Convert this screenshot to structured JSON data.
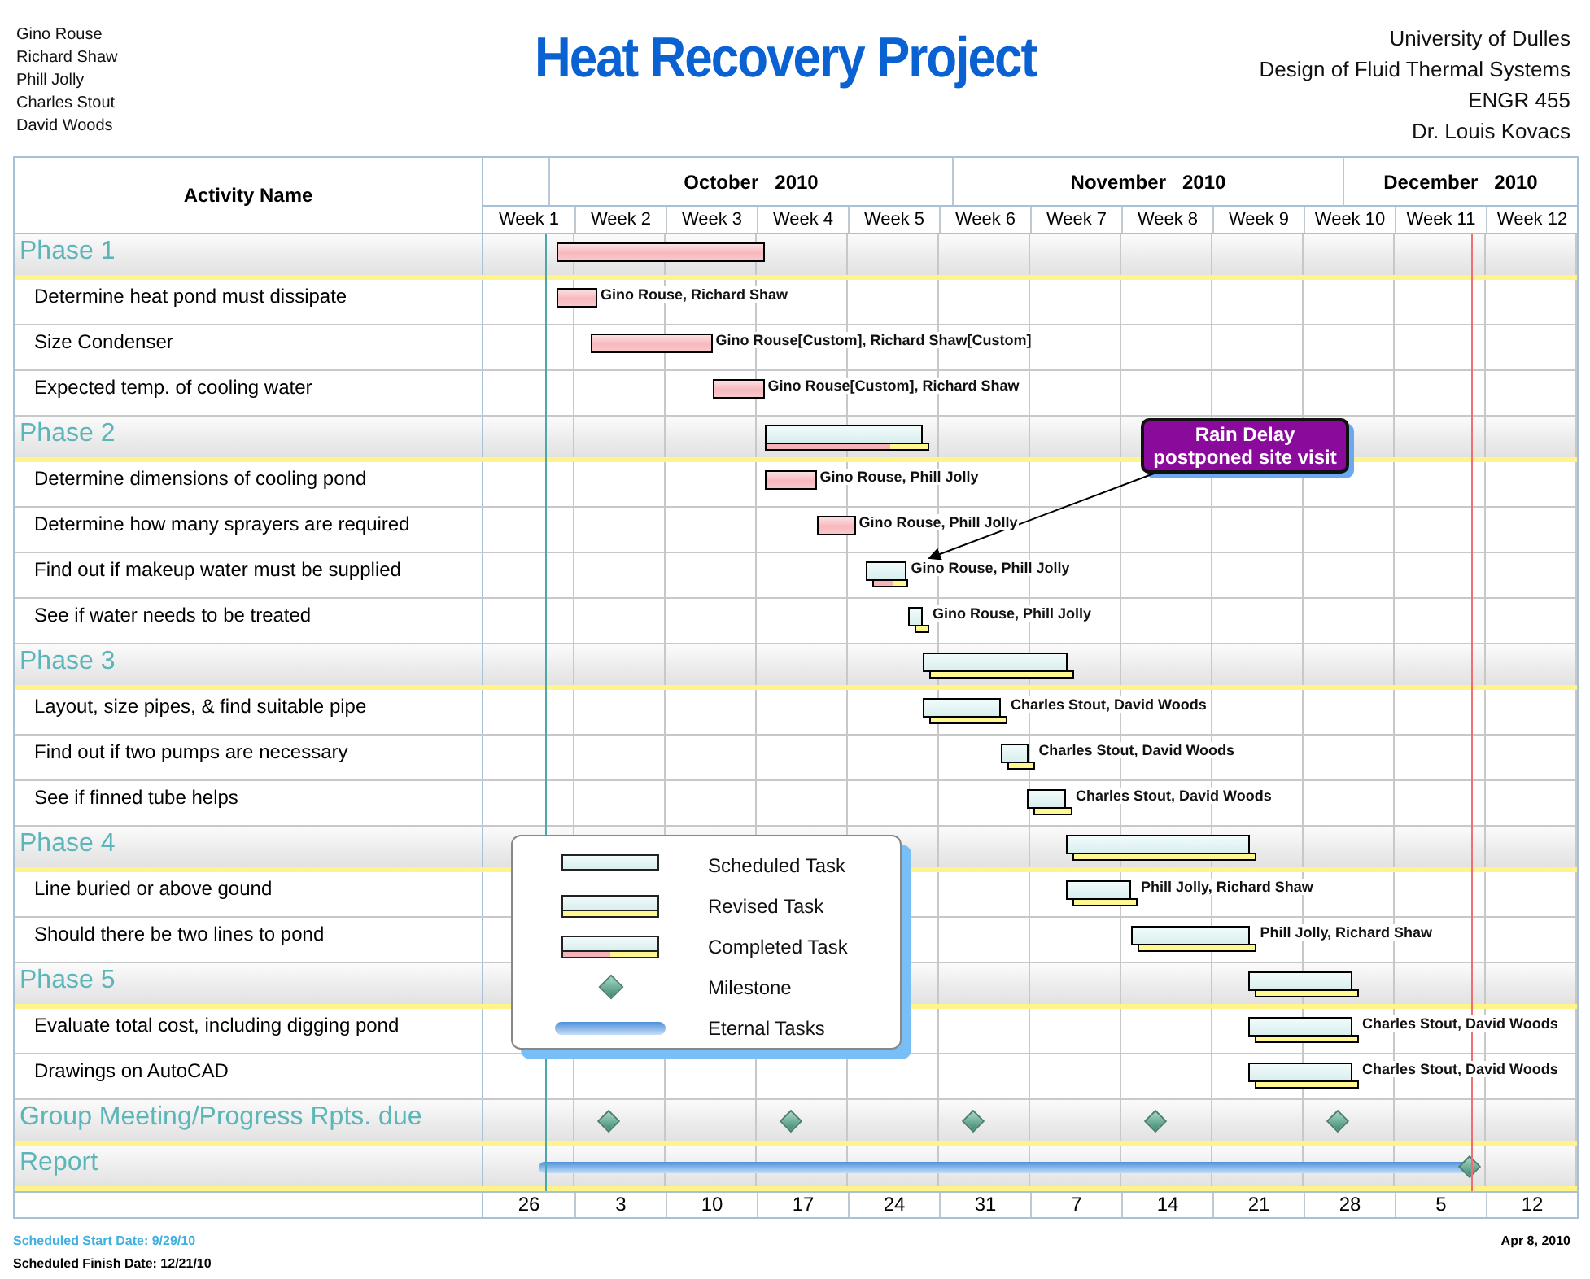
{
  "header": {
    "team": [
      "Gino Rouse",
      "Richard Shaw",
      "Phill Jolly",
      "Charles Stout",
      "David Woods"
    ],
    "title": "Heat Recovery Project",
    "info": [
      "University of Dulles",
      "Design of Fluid Thermal Systems",
      "ENGR 455",
      "Dr. Louis Kovacs"
    ]
  },
  "chart": {
    "activity_heading": "Activity Name",
    "months": [
      "October   2010",
      "November   2010",
      "December   2010"
    ],
    "weeks": [
      "Week 1",
      "Week 2",
      "Week 3",
      "Week 4",
      "Week 5",
      "Week 6",
      "Week 7",
      "Week 8",
      "Week 9",
      "Week 10",
      "Week 11",
      "Week 12"
    ],
    "dates": [
      "26",
      "3",
      "10",
      "17",
      "24",
      "31",
      "7",
      "14",
      "21",
      "28",
      "5",
      "12"
    ],
    "rows": [
      {
        "kind": "phase",
        "name": "Phase 1",
        "bar": {
          "kind": "done"
        }
      },
      {
        "kind": "task",
        "name": "Determine heat pond must dissipate",
        "bar": {
          "kind": "done"
        },
        "resources": "Gino Rouse, Richard Shaw"
      },
      {
        "kind": "task",
        "name": "Size Condenser",
        "bar": {
          "kind": "done"
        },
        "resources": "Gino Rouse[Custom], Richard Shaw[Custom]"
      },
      {
        "kind": "task",
        "name": "Expected temp. of cooling water",
        "bar": {
          "kind": "done"
        },
        "resources": "Gino Rouse[Custom], Richard Shaw"
      },
      {
        "kind": "phase",
        "name": "Phase 2",
        "bar": {
          "kind": "revised",
          "level": 0.77
        }
      },
      {
        "kind": "task",
        "name": "Determine dimensions of cooling pond",
        "bar": {
          "kind": "done"
        },
        "resources": "Gino Rouse, Phill Jolly"
      },
      {
        "kind": "task",
        "name": "Determine how many sprayers are required",
        "bar": {
          "kind": "done"
        },
        "resources": "Gino Rouse, Phill Jolly"
      },
      {
        "kind": "task",
        "name": "Find out if makeup water must be supplied",
        "bar": {
          "kind": "revised",
          "level": 0.6
        },
        "resources": "Gino Rouse, Phill Jolly"
      },
      {
        "kind": "task",
        "name": "See if water needs to be treated",
        "bar": {
          "kind": "revised",
          "level": 0
        },
        "resources": "Gino Rouse, Phill Jolly"
      },
      {
        "kind": "phase",
        "name": "Phase 3",
        "bar": {
          "kind": "revised",
          "level": 0
        }
      },
      {
        "kind": "task",
        "name": "Layout, size pipes, & find suitable pipe",
        "bar": {
          "kind": "revised",
          "level": 0
        },
        "resources": "Charles Stout, David Woods"
      },
      {
        "kind": "task",
        "name": "Find out if two pumps are necessary",
        "bar": {
          "kind": "revised",
          "level": 0
        },
        "resources": "Charles Stout, David Woods"
      },
      {
        "kind": "task",
        "name": "See if finned tube helps",
        "bar": {
          "kind": "revised",
          "level": 0
        },
        "resources": "Charles Stout, David Woods"
      },
      {
        "kind": "phase",
        "name": "Phase 4",
        "bar": {
          "kind": "revised",
          "level": 0
        }
      },
      {
        "kind": "task",
        "name": "Line buried or above gound",
        "bar": {
          "kind": "revised",
          "level": 0
        },
        "resources": "Phill Jolly, Richard Shaw"
      },
      {
        "kind": "task",
        "name": "Should there be two lines to pond",
        "bar": {
          "kind": "revised",
          "level": 0
        },
        "resources": "Phill Jolly, Richard Shaw"
      },
      {
        "kind": "phase",
        "name": "Phase 5",
        "bar": {
          "kind": "revised",
          "level": 0
        }
      },
      {
        "kind": "task",
        "name": "Evaluate total cost, including digging pond",
        "bar": {
          "kind": "revised",
          "level": 0
        },
        "resources": "Charles Stout, David Woods"
      },
      {
        "kind": "task",
        "name": "Drawings on AutoCAD",
        "bar": {
          "kind": "revised",
          "level": 0
        },
        "resources": "Charles Stout, David Woods"
      },
      {
        "kind": "phase",
        "name": "Group Meeting/Progress Rpts. due"
      },
      {
        "kind": "phase",
        "name": "Report",
        "bar": {
          "kind": "eternal"
        }
      }
    ],
    "callout": {
      "lines": [
        "Rain Delay",
        "postponed site visit"
      ]
    },
    "legend": [
      {
        "kind": "scheduled",
        "label": "Scheduled Task"
      },
      {
        "kind": "revised",
        "label": "Revised Task"
      },
      {
        "kind": "completed",
        "label": "Completed Task"
      },
      {
        "kind": "milestone",
        "label": "Milestone"
      },
      {
        "kind": "eternal",
        "label": "Eternal Tasks"
      }
    ]
  },
  "footer": {
    "start": "Scheduled Start Date: 9/29/10",
    "finish": "Scheduled Finish Date: 12/21/10",
    "date": "Apr 8, 2010"
  }
}
